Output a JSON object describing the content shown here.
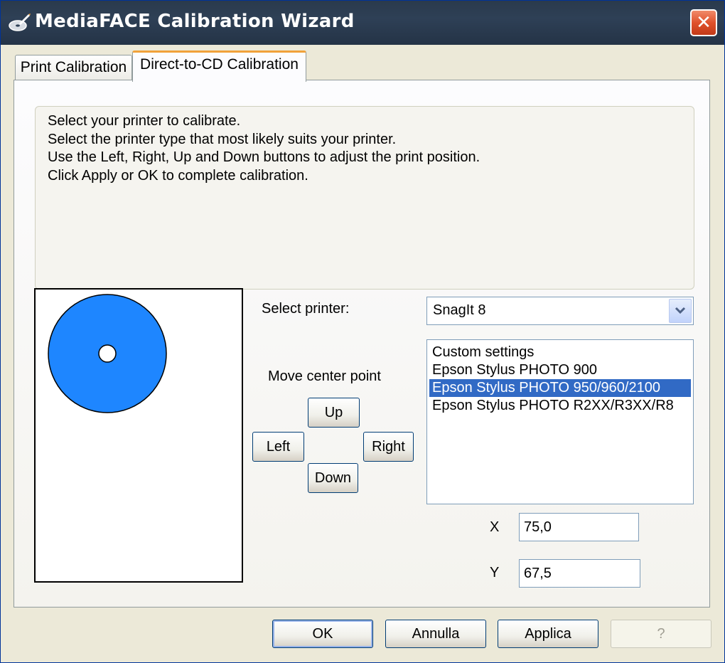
{
  "window": {
    "title": "MediaFACE Calibration Wizard",
    "close_label": "✕"
  },
  "tabs": [
    {
      "label": "Print Calibration",
      "active": false
    },
    {
      "label": "Direct-to-CD Calibration",
      "active": true
    }
  ],
  "instructions": [
    "Select your printer to calibrate.",
    "Select the printer type that most likely suits your printer.",
    "Use the Left, Right, Up and Down buttons to adjust the print position.",
    "Click Apply or OK to complete calibration."
  ],
  "printer": {
    "label": "Select printer:",
    "selected": "SnagIt 8"
  },
  "move": {
    "label": "Move center point",
    "up": "Up",
    "down": "Down",
    "left": "Left",
    "right": "Right"
  },
  "printer_types": {
    "items": [
      "Custom settings",
      "Epson Stylus PHOTO 900",
      "Epson Stylus PHOTO 950/960/2100",
      "Epson Stylus PHOTO R2XX/R3XX/R8"
    ],
    "selected_index": 2
  },
  "coords": {
    "x_label": "X",
    "x_value": "75,0",
    "y_label": "Y",
    "y_value": "67,5"
  },
  "buttons": {
    "ok": "OK",
    "cancel": "Annulla",
    "apply": "Applica",
    "help": "?"
  },
  "colors": {
    "disc": "#1e86ff",
    "selection": "#316ac5",
    "titlebar": "#2e4056",
    "tab_highlight": "#f1a23a"
  }
}
